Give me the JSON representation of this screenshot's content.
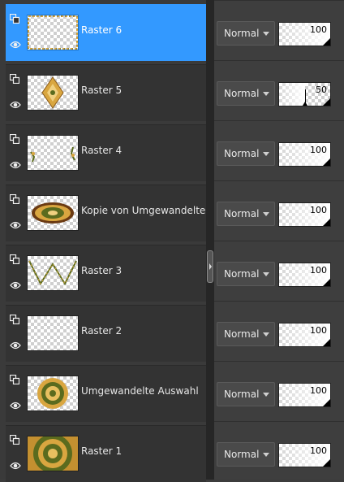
{
  "layers": [
    {
      "name": "Raster 6",
      "blend": "Normal",
      "opacity": "100",
      "opacity_level": 1.0,
      "selected": true,
      "thumb": "border-frame"
    },
    {
      "name": "Raster 5",
      "blend": "Normal",
      "opacity": "50",
      "opacity_level": 0.5,
      "selected": false,
      "thumb": "diamond"
    },
    {
      "name": "Raster 4",
      "blend": "Normal",
      "opacity": "100",
      "opacity_level": 1.0,
      "selected": false,
      "thumb": "corners"
    },
    {
      "name": "Kopie von Umgewandelte Au",
      "blend": "Normal",
      "opacity": "100",
      "opacity_level": 1.0,
      "selected": false,
      "thumb": "lens"
    },
    {
      "name": "Raster 3",
      "blend": "Normal",
      "opacity": "100",
      "opacity_level": 1.0,
      "selected": false,
      "thumb": "zigzag"
    },
    {
      "name": "Raster 2",
      "blend": "Normal",
      "opacity": "100",
      "opacity_level": 1.0,
      "selected": false,
      "thumb": "empty"
    },
    {
      "name": "Umgewandelte Auswahl",
      "blend": "Normal",
      "opacity": "100",
      "opacity_level": 1.0,
      "selected": false,
      "thumb": "ring"
    },
    {
      "name": "Raster 1",
      "blend": "Normal",
      "opacity": "100",
      "opacity_level": 1.0,
      "selected": false,
      "thumb": "rings-fill"
    }
  ],
  "icons": {
    "link": "link-icon",
    "visibility": "eye-icon",
    "dropdown": "chevron-down-icon"
  },
  "colors": {
    "selection": "#3399ff",
    "row_bg": "#333333",
    "panel_bg": "#3c3c3c",
    "thumb_gold": "#d9a640",
    "thumb_green": "#5b6b1e"
  }
}
